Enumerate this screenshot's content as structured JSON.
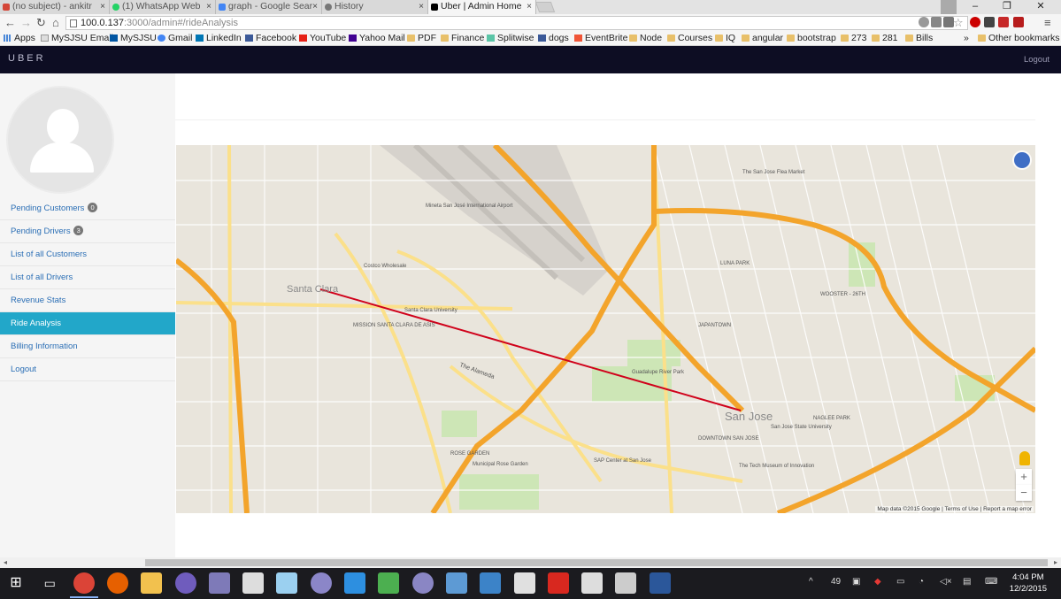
{
  "browser": {
    "tabs": [
      {
        "label": "(no subject) - ankitr",
        "icon": "gmail-icon",
        "color": "#d44638"
      },
      {
        "label": "(1) WhatsApp Web",
        "icon": "whatsapp-icon",
        "color": "#25d366"
      },
      {
        "label": "graph - Google Sear",
        "icon": "google-icon",
        "color": "#4285f4"
      },
      {
        "label": "History",
        "icon": "history-icon",
        "color": "#777777"
      },
      {
        "label": "Uber | Admin Home",
        "icon": "uber-icon",
        "color": "#000000"
      }
    ],
    "url_host": "100.0.137",
    "url_rest": ":3000/admin#/rideAnalysis",
    "bookmarks": [
      {
        "label": "Apps",
        "icon": "apps-icon"
      },
      {
        "label": "MySJSU Email",
        "icon": "page-icon"
      },
      {
        "label": "MySJSU",
        "icon": "sjsu-icon"
      },
      {
        "label": "Gmail",
        "icon": "google-icon"
      },
      {
        "label": "LinkedIn",
        "icon": "linkedin-icon"
      },
      {
        "label": "Facebook",
        "icon": "facebook-icon"
      },
      {
        "label": "YouTube",
        "icon": "youtube-icon"
      },
      {
        "label": "Yahoo Mail",
        "icon": "yahoo-icon"
      },
      {
        "label": "PDF",
        "icon": "folder-icon"
      },
      {
        "label": "Finance",
        "icon": "folder-icon"
      },
      {
        "label": "Splitwise",
        "icon": "splitwise-icon"
      },
      {
        "label": "dogs",
        "icon": "facebook-icon"
      },
      {
        "label": "EventBrite",
        "icon": "eventbrite-icon"
      },
      {
        "label": "Node",
        "icon": "folder-icon"
      },
      {
        "label": "Courses",
        "icon": "folder-icon"
      },
      {
        "label": "IQ",
        "icon": "folder-icon"
      },
      {
        "label": "angular",
        "icon": "folder-icon"
      },
      {
        "label": "bootstrap",
        "icon": "folder-icon"
      },
      {
        "label": "273",
        "icon": "folder-icon"
      },
      {
        "label": "281",
        "icon": "folder-icon"
      },
      {
        "label": "Bills",
        "icon": "folder-icon"
      }
    ],
    "more_bookmarks": "»",
    "other_bookmarks": "Other bookmarks"
  },
  "app": {
    "brand": "UBER",
    "logout_label": "Logout",
    "accent": "#22a7c9",
    "navbar_color": "#0d0d23",
    "menu": [
      {
        "label": "Pending Customers",
        "badge": "0"
      },
      {
        "label": "Pending Drivers",
        "badge": "3"
      },
      {
        "label": "List of all Customers"
      },
      {
        "label": "List of all Drivers"
      },
      {
        "label": "Revenue Stats"
      },
      {
        "label": "Ride Analysis",
        "active": true
      },
      {
        "label": "Billing Information"
      },
      {
        "label": "Logout"
      }
    ]
  },
  "map": {
    "route_color": "#d0021b",
    "labels": {
      "santa_clara": "Santa Clara",
      "san_jose": "San Jose",
      "airport": "Mineta San José International Airport",
      "scu": "Santa Clara University",
      "mission": "MISSION SANTA CLARA DE ASIS",
      "sjsu": "San Jose State University",
      "sap": "SAP Center at San Jose",
      "rose_garden": "ROSE GARDEN",
      "rose_garden_park": "Municipal Rose Garden",
      "alameda": "The Alameda",
      "japantown": "JAPANTOWN",
      "downtown": "DOWNTOWN SAN JOSE",
      "flea": "The San Jose Flea Market",
      "tech": "The Tech Museum of Innovation",
      "naglee": "NAGLEE PARK",
      "guadalupe": "Guadalupe River Park",
      "luna": "LUNA PARK",
      "costco": "Costco Wholesale",
      "fairgrounds": "WOOSTER - 26TH"
    },
    "zoom_in": "+",
    "zoom_out": "−",
    "footer": "Map data ©2015 Google | Terms of Use | Report a map error"
  },
  "taskbar": {
    "apps": [
      {
        "name": "start-icon",
        "color": "#ffffff"
      },
      {
        "name": "task-view-icon",
        "color": "#ffffff"
      },
      {
        "name": "chrome-icon",
        "color": "#db4437",
        "active": true
      },
      {
        "name": "firefox-icon",
        "color": "#e66000"
      },
      {
        "name": "file-explorer-icon",
        "color": "#f2c14e"
      },
      {
        "name": "eclipse-icon",
        "color": "#6f5cbd"
      },
      {
        "name": "eclipse2-icon",
        "color": "#7e7ab8"
      },
      {
        "name": "calculator-icon",
        "color": "#dddddd"
      },
      {
        "name": "notepad-icon",
        "color": "#9bd0f0"
      },
      {
        "name": "eclipse3-icon",
        "color": "#8b86c8"
      },
      {
        "name": "edge-icon",
        "color": "#2d8fe0"
      },
      {
        "name": "excel-tool-icon",
        "color": "#4caf50"
      },
      {
        "name": "eclipse4-icon",
        "color": "#8a86c4"
      },
      {
        "name": "mysql-icon",
        "color": "#5d9ad4"
      },
      {
        "name": "vs-icon",
        "color": "#3c83c8"
      },
      {
        "name": "paint-icon",
        "color": "#e0e0e0"
      },
      {
        "name": "filezilla-icon",
        "color": "#d8281f"
      },
      {
        "name": "terminal-icon",
        "color": "#dddddd"
      },
      {
        "name": "settings-icon",
        "color": "#cccccc"
      },
      {
        "name": "word-icon",
        "color": "#2b579a"
      }
    ],
    "tray_count": "49",
    "time": "4:04 PM",
    "date": "12/2/2015"
  }
}
